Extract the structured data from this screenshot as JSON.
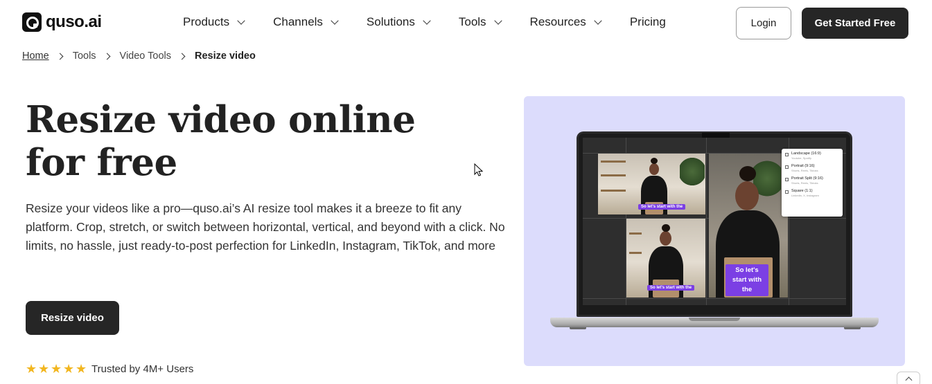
{
  "brand": {
    "name": "quso.ai"
  },
  "nav": {
    "items": [
      {
        "label": "Products",
        "has_dropdown": true
      },
      {
        "label": "Channels",
        "has_dropdown": true
      },
      {
        "label": "Solutions",
        "has_dropdown": true
      },
      {
        "label": "Tools",
        "has_dropdown": true
      },
      {
        "label": "Resources",
        "has_dropdown": true
      },
      {
        "label": "Pricing",
        "has_dropdown": false
      }
    ],
    "login_label": "Login",
    "cta_label": "Get Started Free"
  },
  "breadcrumb": {
    "home": "Home",
    "level1": "Tools",
    "level2": "Video Tools",
    "current": "Resize video"
  },
  "hero": {
    "title": "Resize video online for free",
    "description": "Resize your videos like a pro—quso.ai’s AI resize tool makes it a breeze to fit any platform. Crop, stretch, or switch between horizontal, vertical, and beyond with a click. No limits, no hassle, just ready-to-post perfection for LinkedIn, Instagram, TikTok, and more",
    "button_label": "Resize video",
    "rating_stars": 5,
    "trust_text": "Trusted by 4M+ Users"
  },
  "preview": {
    "caption_small_1": "So let's start with the",
    "caption_small_2": "So let's start with the",
    "caption_big": "So let's start with the",
    "options": [
      {
        "title": "Landscape (16:9)",
        "sub": "Youtube, Spotify"
      },
      {
        "title": "Portrait (9:16)",
        "sub": "Shorts, Reels, Tiktoks"
      },
      {
        "title": "Portrait Split (9:16)",
        "sub": "Shorts, Reels, Tiktoks"
      },
      {
        "title": "Square (1:1)",
        "sub": "Linkedin, X, Instagram"
      }
    ]
  },
  "colors": {
    "panel_bg": "#dcdcfc",
    "button_dark": "#262626",
    "caption_purple": "#7b3fe4",
    "star": "#f2b61f"
  }
}
